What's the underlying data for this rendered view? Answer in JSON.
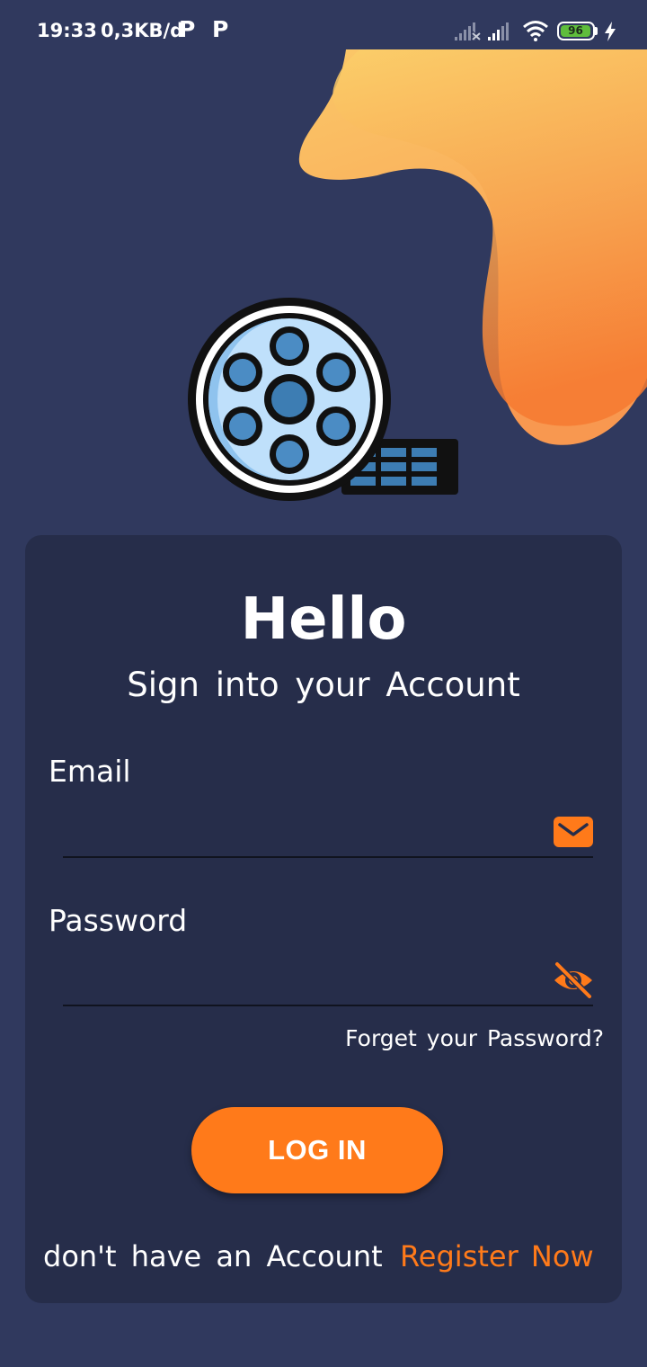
{
  "status_bar": {
    "time": "19:33",
    "network_speed": "0,3KB/d",
    "app_icons": [
      "P",
      "P"
    ],
    "battery_level": "96"
  },
  "login": {
    "title": "Hello",
    "subtitle": "Sign into your Account",
    "email_label": "Email",
    "email_value": "",
    "password_label": "Password",
    "password_value": "",
    "forgot_password": "Forget your Password?",
    "login_button": "LOG IN",
    "no_account_text": "don't have an Account",
    "register_link": "Register Now"
  },
  "colors": {
    "background": "#30395e",
    "card": "#262d4a",
    "accent": "#ff7a1a"
  },
  "icons": {
    "logo": "film-reel-icon",
    "email": "envelope-icon",
    "password": "eye-off-icon"
  }
}
